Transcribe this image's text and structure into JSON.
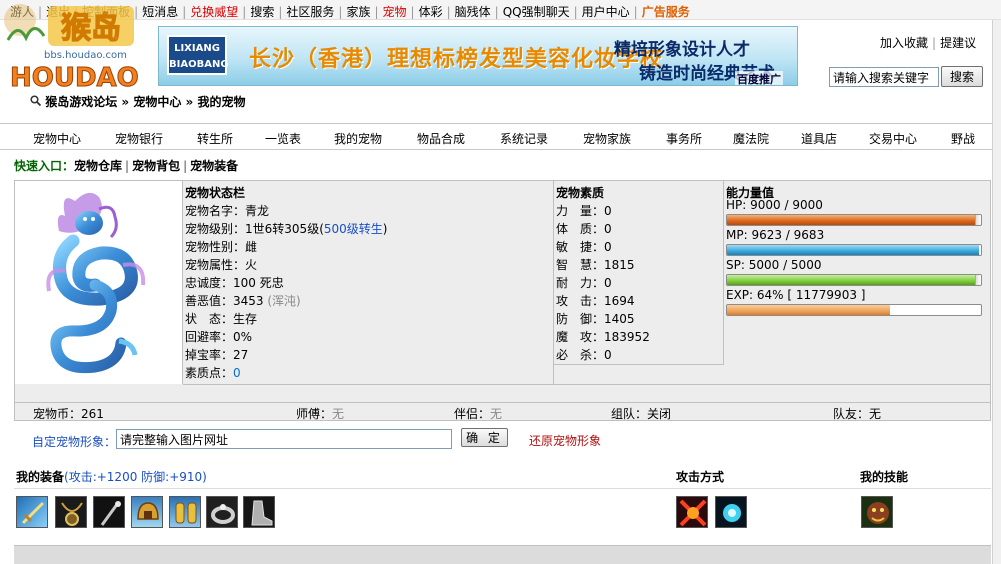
{
  "topbar": {
    "links": [
      {
        "label": "游人",
        "style": "normal"
      },
      {
        "label": "退出",
        "style": "normal"
      },
      {
        "label": "控制面板",
        "style": "normal"
      },
      {
        "label": "短消息",
        "style": "normal"
      },
      {
        "label": "兑换威望",
        "style": "red"
      },
      {
        "label": "搜索",
        "style": "normal"
      },
      {
        "label": "社区服务",
        "style": "normal"
      },
      {
        "label": "家族",
        "style": "normal"
      },
      {
        "label": "宠物",
        "style": "red"
      },
      {
        "label": "体彩",
        "style": "normal"
      },
      {
        "label": "脑残体",
        "style": "normal"
      },
      {
        "label": "QQ强制聊天",
        "style": "normal"
      },
      {
        "label": "用户中心",
        "style": "normal"
      },
      {
        "label": "广告服务",
        "style": "orange"
      }
    ]
  },
  "logo": {
    "main": "猴岛",
    "url_text": "bbs.houdao.com",
    "wordmark": "HOUDAO"
  },
  "banner": {
    "brand_line1": "LIXIANG",
    "brand_line2": "BIAOBANG",
    "headline": "长沙（香港）理想标榜发型美容化妆学校",
    "slogan1": "精培形象设计人才",
    "slogan2": "铸造时尚经典艺术",
    "badge": "百度推广"
  },
  "header": {
    "add_favorite": "加入收藏",
    "suggest": "提建议",
    "search_placeholder": "请输入搜索关键字",
    "search_button": "搜索"
  },
  "breadcrumb": {
    "items": [
      "猴岛游戏论坛",
      "宠物中心",
      "我的宠物"
    ],
    "sep": " » "
  },
  "nav": {
    "items": [
      "宠物中心",
      "宠物银行",
      "转生所",
      "一览表",
      "我的宠物",
      "物品合成",
      "系统记录",
      "宠物家族",
      "事务所",
      "魔法院",
      "道具店",
      "交易中心",
      "野战"
    ]
  },
  "quick": {
    "label": "快速入口：",
    "links": [
      "宠物仓库",
      "宠物背包",
      "宠物装备"
    ],
    "sep": "|"
  },
  "status": {
    "title": "宠物状态栏",
    "rows": [
      {
        "label": "宠物名字：",
        "value": "青龙",
        "extra": ""
      },
      {
        "label": "宠物级别：",
        "value": "1世6转305级(",
        "extra": "500级转生",
        "after": ")"
      },
      {
        "label": "宠物性别：",
        "value": "雌",
        "extra": ""
      },
      {
        "label": "宠物属性：",
        "value": "火",
        "extra": ""
      },
      {
        "label": "忠诚度：",
        "value": "100 死忠",
        "extra": ""
      },
      {
        "label": "善恶值：",
        "value": "3453 ",
        "extra": "(浑沌)"
      },
      {
        "label": "状　态：",
        "value": "生存",
        "extra": ""
      },
      {
        "label": "回避率：",
        "value": "0%",
        "extra": ""
      },
      {
        "label": "掉宝率：",
        "value": "27",
        "extra": ""
      },
      {
        "label": "素质点：",
        "value": "",
        "extra": "0"
      }
    ]
  },
  "quality": {
    "title": "宠物素质",
    "rows": [
      {
        "label": "力　量：",
        "value": "0"
      },
      {
        "label": "体　质：",
        "value": "0"
      },
      {
        "label": "敏　捷：",
        "value": "0"
      },
      {
        "label": "智　慧：",
        "value": "1815"
      },
      {
        "label": "耐　力：",
        "value": "0"
      },
      {
        "label": "攻　击：",
        "value": "1694"
      },
      {
        "label": "防　御：",
        "value": "1405"
      },
      {
        "label": "魔　攻：",
        "value": "183952"
      },
      {
        "label": "必　杀：",
        "value": "0"
      }
    ]
  },
  "energy": {
    "title": "能力量值",
    "bars": [
      {
        "label": "HP:  9000 / 9000",
        "fill": 1.0,
        "kind": "hp"
      },
      {
        "label": "MP:  9623 / 9683",
        "fill": 0.994,
        "kind": "mp"
      },
      {
        "label": "SP:  5000 / 5000",
        "fill": 1.0,
        "kind": "sp"
      },
      {
        "label": "EXP:  64%  [ 11779903 ]",
        "fill": 0.64,
        "kind": "exp"
      }
    ]
  },
  "info": {
    "coins_label": "宠物币：",
    "coins": "261",
    "master_label": "师傅：",
    "master": "无",
    "partner_label": "伴侣：",
    "partner": "无",
    "team_label": "组队：",
    "team": "关闭",
    "teammate_label": "队友：",
    "teammate": "无"
  },
  "custom": {
    "label": "自定宠物形象：",
    "input_value": "请完整输入图片网址",
    "confirm": "确 定",
    "restore": "还原宠物形象"
  },
  "equipment": {
    "title": "我的装备",
    "stats": "(攻击:+1200 防御:+910)",
    "items": [
      "sword",
      "amulet",
      "staff",
      "helmet",
      "gauntlets",
      "ring",
      "boots"
    ]
  },
  "attack": {
    "title": "攻击方式",
    "items": [
      "flame-strike",
      "orb-blast"
    ]
  },
  "skills": {
    "title": "我的技能",
    "items": [
      "beast-skill"
    ]
  }
}
